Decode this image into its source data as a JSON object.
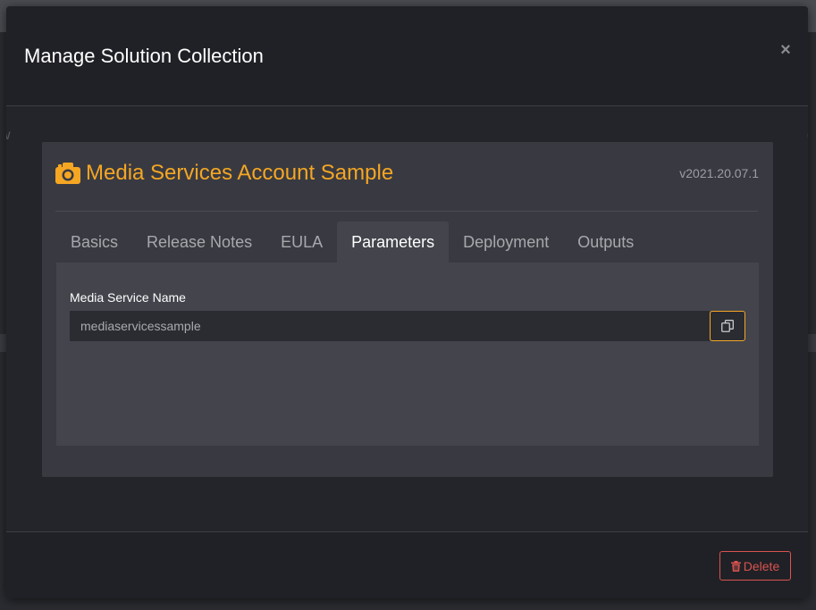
{
  "modal": {
    "title": "Manage Solution Collection",
    "close_symbol": "×",
    "close_icon": "close-icon"
  },
  "background": {
    "ghost_left": "w",
    "ghost_right": "d"
  },
  "card": {
    "icon": "camera-icon",
    "title": "Media Services Account Sample",
    "version": "v2021.20.07.1",
    "accent_color": "#f5a623"
  },
  "tabs": [
    {
      "label": "Basics",
      "active": false
    },
    {
      "label": "Release Notes",
      "active": false
    },
    {
      "label": "EULA",
      "active": false
    },
    {
      "label": "Parameters",
      "active": true
    },
    {
      "label": "Deployment",
      "active": false
    },
    {
      "label": "Outputs",
      "active": false
    }
  ],
  "parameters": {
    "field_label": "Media Service Name",
    "field_value": "mediaservicessample",
    "copy_icon": "copy-icon"
  },
  "footer": {
    "delete_label": "Delete",
    "delete_icon": "trash-icon",
    "delete_color": "#d9534f"
  }
}
